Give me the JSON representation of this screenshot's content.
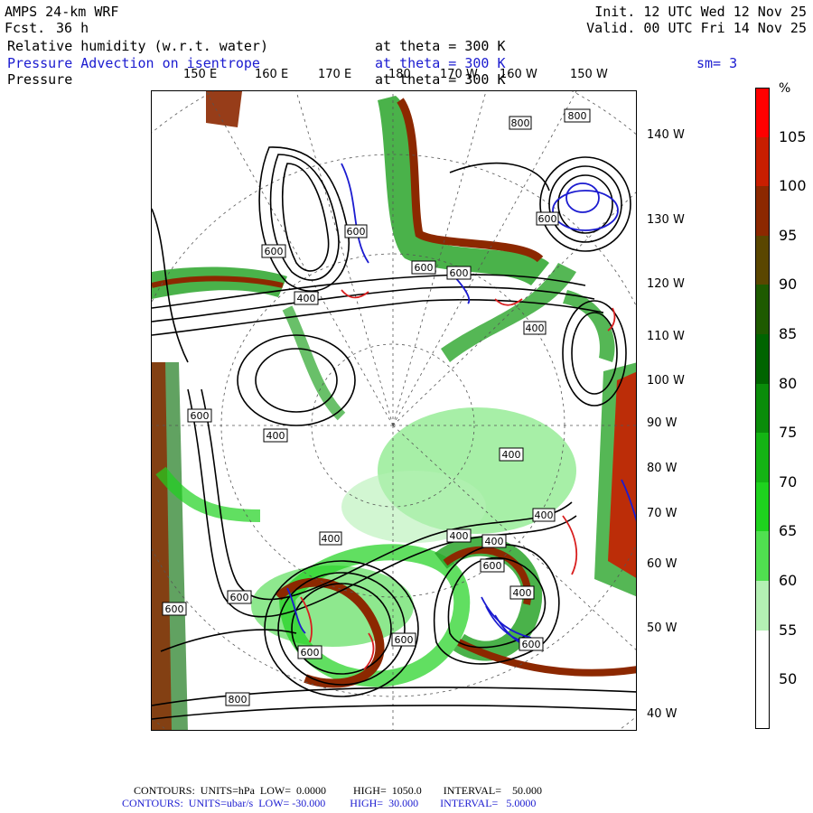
{
  "header": {
    "model": "AMPS 24-km WRF",
    "forecast_label": "Fcst.",
    "forecast_hours": "36 h",
    "init": "Init. 12 UTC Wed 12 Nov 25",
    "valid": "Valid. 00 UTC Fri 14 Nov 25",
    "field1": "Relative humidity (w.r.t. water)",
    "field1_level": "at theta = 300 K",
    "field2": "Pressure Advection on isentrope",
    "field2_level": "at theta = 300 K",
    "smoothing": "sm= 3",
    "field3": "Pressure",
    "field3_level": "at theta = 300 K"
  },
  "lon_labels": [
    "150 E",
    "160 E",
    "170 E",
    "180",
    "170 W",
    "160 W",
    "150 W"
  ],
  "lat_labels": [
    "140 W",
    "130 W",
    "120 W",
    "110 W",
    "100 W",
    "90 W",
    "80 W",
    "70 W",
    "60 W",
    "50 W",
    "40 W"
  ],
  "colorbar": {
    "unit": "%",
    "levels": [
      "105",
      "100",
      "95",
      "90",
      "85",
      "80",
      "75",
      "70",
      "65",
      "60",
      "55",
      "50"
    ],
    "colors": [
      "#ff0000",
      "#c81e00",
      "#8c2800",
      "#5a4600",
      "#1e5a00",
      "#006400",
      "#0a8c0a",
      "#14b414",
      "#1ed21e",
      "#50e050",
      "#b4f0b4",
      "#ffffff",
      "#ffffff"
    ]
  },
  "contour_labels": [
    "800",
    "800",
    "600",
    "600",
    "600",
    "600",
    "400",
    "600",
    "400",
    "600",
    "400",
    "400",
    "400",
    "400",
    "400",
    "400",
    "600",
    "400",
    "600",
    "600",
    "600",
    "600",
    "600",
    "800"
  ],
  "footer": {
    "line1": "CONTOURS:  UNITS=hPa  LOW=  0.0000          HIGH=  1050.0        INTERVAL=    50.000",
    "line2": "CONTOURS:  UNITS=ubar/s  LOW= -30.000         HIGH=  30.000        INTERVAL=   5.0000"
  }
}
